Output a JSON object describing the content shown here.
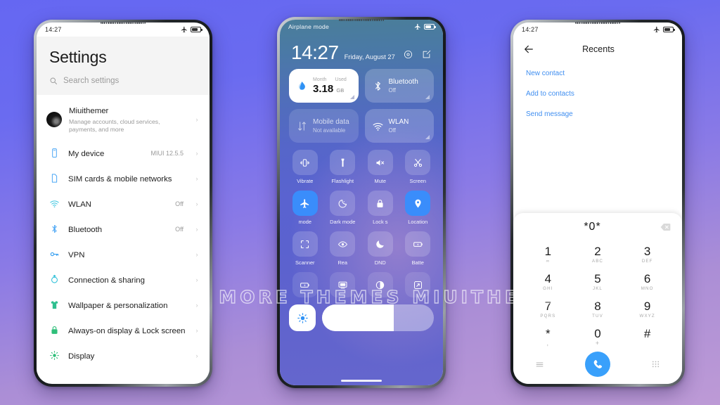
{
  "watermark": "VISIT FOR MORE THEMES MIUITHEMER.COM",
  "left_phone": {
    "status": {
      "time": "14:27",
      "airplane_icon": "airplane-icon",
      "battery_icon": "battery-icon"
    },
    "title": "Settings",
    "search": {
      "placeholder": "Search settings",
      "icon": "search-icon"
    },
    "account": {
      "name": "Miuithemer",
      "subtitle": "Manage accounts, cloud services, payments, and more",
      "avatar": "avatar"
    },
    "items": [
      {
        "label": "My device",
        "value": "MIUI 12.5.5",
        "icon": "phone-icon",
        "color": "#4aa6f5"
      },
      {
        "label": "SIM cards & mobile networks",
        "value": "",
        "icon": "sim-card-icon",
        "color": "#4aa6f5"
      },
      {
        "label": "WLAN",
        "value": "Off",
        "icon": "wifi-icon",
        "color": "#3ec6e0"
      },
      {
        "label": "Bluetooth",
        "value": "Off",
        "icon": "bluetooth-icon",
        "color": "#4aa6f5"
      },
      {
        "label": "VPN",
        "value": "",
        "icon": "key-icon",
        "color": "#2f9bf0"
      },
      {
        "label": "Connection & sharing",
        "value": "",
        "icon": "share-circle-icon",
        "color": "#2fc0d9"
      },
      {
        "label": "Wallpaper & personalization",
        "value": "",
        "icon": "tshirt-icon",
        "color": "#2fbf8f"
      },
      {
        "label": "Always-on display & Lock screen",
        "value": "",
        "icon": "lock-icon",
        "color": "#2fbf7a"
      },
      {
        "label": "Display",
        "value": "",
        "icon": "brightness-icon",
        "color": "#2fbf7a"
      }
    ]
  },
  "mid_phone": {
    "status": {
      "airplane_label": "Airplane mode",
      "airplane_icon": "airplane-icon",
      "battery_icon": "battery-icon"
    },
    "clock": "14:27",
    "date": "Friday, August 27",
    "header_icons": [
      "settings-gear-icon",
      "edit-icon"
    ],
    "big_tiles": [
      {
        "id": "data-usage",
        "state": "on",
        "icon": "data-drop-icon",
        "small_left": "Month",
        "small_right": "Used",
        "value": "3.18",
        "unit": "GB"
      },
      {
        "id": "bluetooth",
        "state": "off",
        "label": "Bluetooth",
        "sub": "Off",
        "icon": "bluetooth-icon"
      },
      {
        "id": "mobile-data",
        "state": "dim",
        "label": "Mobile data",
        "sub": "Not available",
        "icon": "data-arrows-icon"
      },
      {
        "id": "wlan",
        "state": "off",
        "label": "WLAN",
        "sub": "Off",
        "icon": "wifi-icon"
      }
    ],
    "toggles": [
      {
        "label": "Vibrate",
        "icon": "vibrate-icon",
        "state": "off"
      },
      {
        "label": "Flashlight",
        "icon": "flashlight-icon",
        "state": "off"
      },
      {
        "label": "Mute",
        "icon": "mute-icon",
        "state": "off"
      },
      {
        "label": "Screen",
        "icon": "scissors-icon",
        "state": "off"
      },
      {
        "label": "mode",
        "icon": "airplane-icon",
        "state": "active"
      },
      {
        "label": "Dark mode",
        "icon": "dark-mode-icon",
        "state": "off"
      },
      {
        "label": "Lock s",
        "icon": "lock-icon",
        "state": "off"
      },
      {
        "label": "Location",
        "icon": "location-pin-icon",
        "state": "active"
      },
      {
        "label": "Scanner",
        "icon": "scan-frame-icon",
        "state": "off"
      },
      {
        "label": "Rea",
        "icon": "eye-icon",
        "state": "off"
      },
      {
        "label": "DND",
        "icon": "moon-icon",
        "state": "off"
      },
      {
        "label": "Batte",
        "icon": "battery-saver-icon",
        "state": "off"
      },
      {
        "label": "",
        "icon": "battery-icon",
        "state": "off"
      },
      {
        "label": "",
        "icon": "cast-icon",
        "state": "off"
      },
      {
        "label": "",
        "icon": "contrast-icon",
        "state": "off"
      },
      {
        "label": "",
        "icon": "expand-icon",
        "state": "off"
      }
    ],
    "brightness": {
      "icon": "brightness-icon",
      "level": 64
    }
  },
  "right_phone": {
    "status": {
      "time": "14:27",
      "airplane_icon": "airplane-icon",
      "battery_icon": "battery-icon"
    },
    "back_icon": "back-arrow-icon",
    "title": "Recents",
    "actions": [
      "New contact",
      "Add to contacts",
      "Send message"
    ],
    "dial_value": "*0*",
    "backspace_icon": "backspace-icon",
    "keys": [
      {
        "n": "1",
        "s": "∞"
      },
      {
        "n": "2",
        "s": "ABC"
      },
      {
        "n": "3",
        "s": "DEF"
      },
      {
        "n": "4",
        "s": "GHI"
      },
      {
        "n": "5",
        "s": "JKL"
      },
      {
        "n": "6",
        "s": "MNO"
      },
      {
        "n": "7",
        "s": "PQRS"
      },
      {
        "n": "8",
        "s": "TUV"
      },
      {
        "n": "9",
        "s": "WXYZ"
      },
      {
        "n": "*",
        "s": ","
      },
      {
        "n": "0",
        "s": "+"
      },
      {
        "n": "#",
        "s": ""
      }
    ],
    "bottom": {
      "menu_icon": "menu-icon",
      "call_icon": "call-icon",
      "keypad_icon": "keypad-icon"
    }
  },
  "colors": {
    "bg_top": "#6567f2",
    "bg_bottom": "#bd9ad6",
    "accent_blue": "#3a8dfb",
    "link_blue": "#3f8ef0",
    "call_green_blue": "#39a0fb"
  }
}
